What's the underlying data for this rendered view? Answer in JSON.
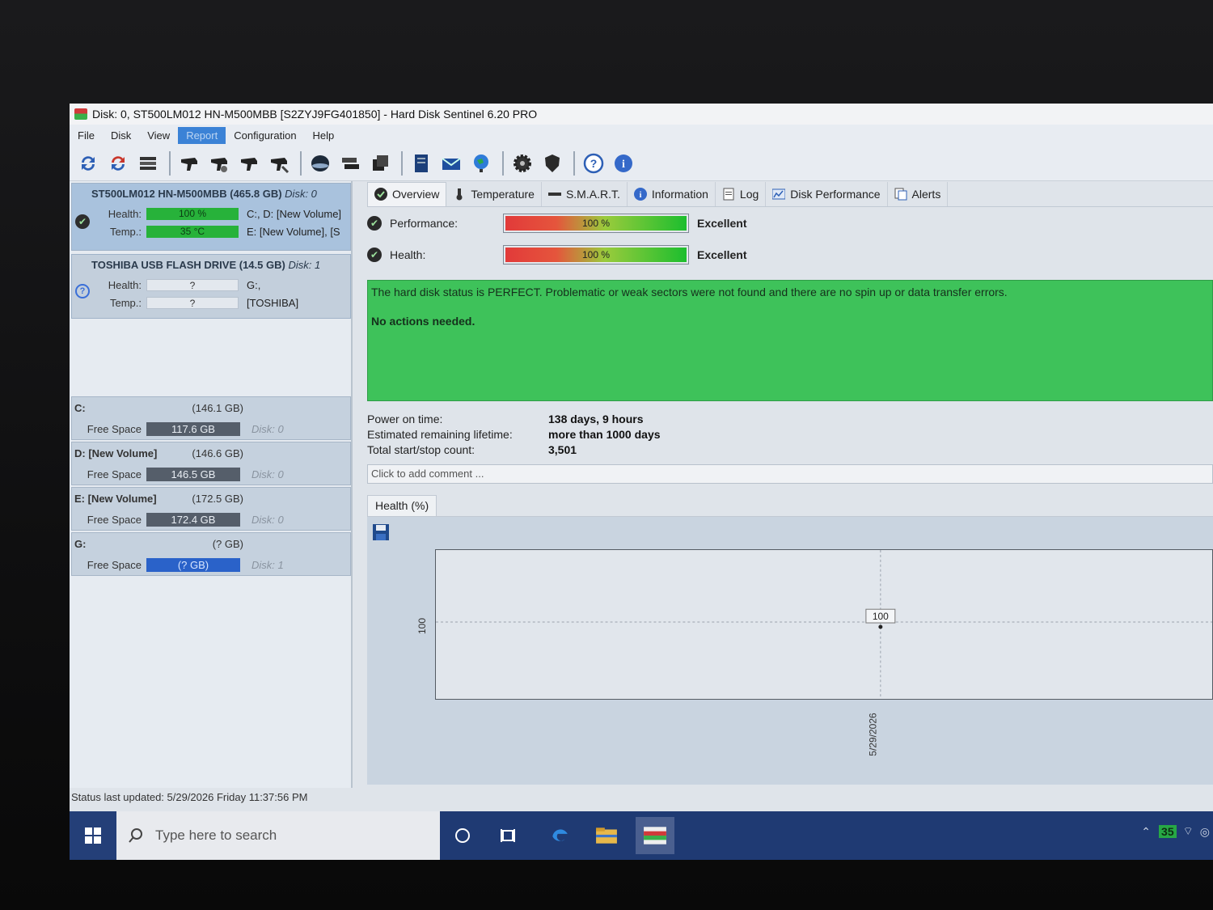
{
  "window": {
    "title": "Disk: 0, ST500LM012 HN-M500MBB [S2ZYJ9FG401850]  -  Hard Disk Sentinel 6.20 PRO"
  },
  "menu": [
    "File",
    "Disk",
    "View",
    "Report",
    "Configuration",
    "Help"
  ],
  "toolbar_icons": [
    "refresh-icon",
    "refresh-all-icon",
    "list-icon",
    "hdd-icon",
    "hdd-test-icon",
    "hdd-info-icon",
    "hdd-settings-icon",
    "disk-icon",
    "drives-icon",
    "backup-icon",
    "report-icon",
    "email-icon",
    "network-icon",
    "gear-icon",
    "shield-icon",
    "help-icon",
    "info-icon"
  ],
  "disks": [
    {
      "name": "ST500LM012 HN-M500MBB",
      "size": "(465.8 GB)",
      "disk_num": "Disk: 0",
      "health_label": "Health:",
      "health": "100 %",
      "temp_label": "Temp.:",
      "temp": "35 °C",
      "vol1": "C:, D: [New Volume]",
      "vol2": "E: [New Volume],  [S"
    },
    {
      "name": "TOSHIBA USB FLASH DRIVE",
      "size": "(14.5 GB)",
      "disk_num": "Disk: 1",
      "health_label": "Health:",
      "health": "?",
      "temp_label": "Temp.:",
      "temp": "?",
      "vol1": "G:,",
      "vol2": "[TOSHIBA]"
    }
  ],
  "volumes": [
    {
      "name": "C:",
      "size": "(146.1 GB)",
      "free_label": "Free Space",
      "free": "117.6 GB",
      "disk": "Disk: 0"
    },
    {
      "name": "D: [New Volume]",
      "size": "(146.6 GB)",
      "free_label": "Free Space",
      "free": "146.5 GB",
      "disk": "Disk: 0"
    },
    {
      "name": "E: [New Volume]",
      "size": "(172.5 GB)",
      "free_label": "Free Space",
      "free": "172.4 GB",
      "disk": "Disk: 0"
    },
    {
      "name": "G:",
      "size": "(? GB)",
      "free_label": "Free Space",
      "free": "(? GB)",
      "disk": "Disk: 1"
    }
  ],
  "status_bar": "Status last updated: 5/29/2026 Friday 11:37:56 PM",
  "tabs": [
    "Overview",
    "Temperature",
    "S.M.A.R.T.",
    "Information",
    "Log",
    "Disk Performance",
    "Alerts"
  ],
  "performance": {
    "label": "Performance:",
    "value": "100 %",
    "rating": "Excellent",
    "fraction": 1.0
  },
  "health": {
    "label": "Health:",
    "value": "100 %",
    "rating": "Excellent",
    "fraction": 1.0
  },
  "status_message": "The hard disk status is PERFECT. Problematic or weak sectors were not found and there are no spin up or data transfer errors.",
  "status_action": "No actions needed.",
  "info": [
    {
      "key": "Power on time:",
      "value": "138 days, 9 hours"
    },
    {
      "key": "Estimated remaining lifetime:",
      "value": "more than 1000 days"
    },
    {
      "key": "Total start/stop count:",
      "value": "3,501"
    }
  ],
  "comment_placeholder": "Click to add comment ...",
  "chart_tab": "Health (%)",
  "chart_data": {
    "type": "line",
    "x": [
      "5/29/2026"
    ],
    "series": [
      {
        "values": [
          100
        ]
      }
    ],
    "ytick_labels": [
      "100"
    ],
    "data_labels": [
      "100"
    ],
    "grid": true
  },
  "taskbar": {
    "search_placeholder": "Type here to search",
    "tray_badge": "35"
  },
  "colors": {
    "status_green": "#3ec25a",
    "bar_green": "#27b23a",
    "report_menu_active": "#3b82d6",
    "taskbar": "#1f3a73"
  }
}
